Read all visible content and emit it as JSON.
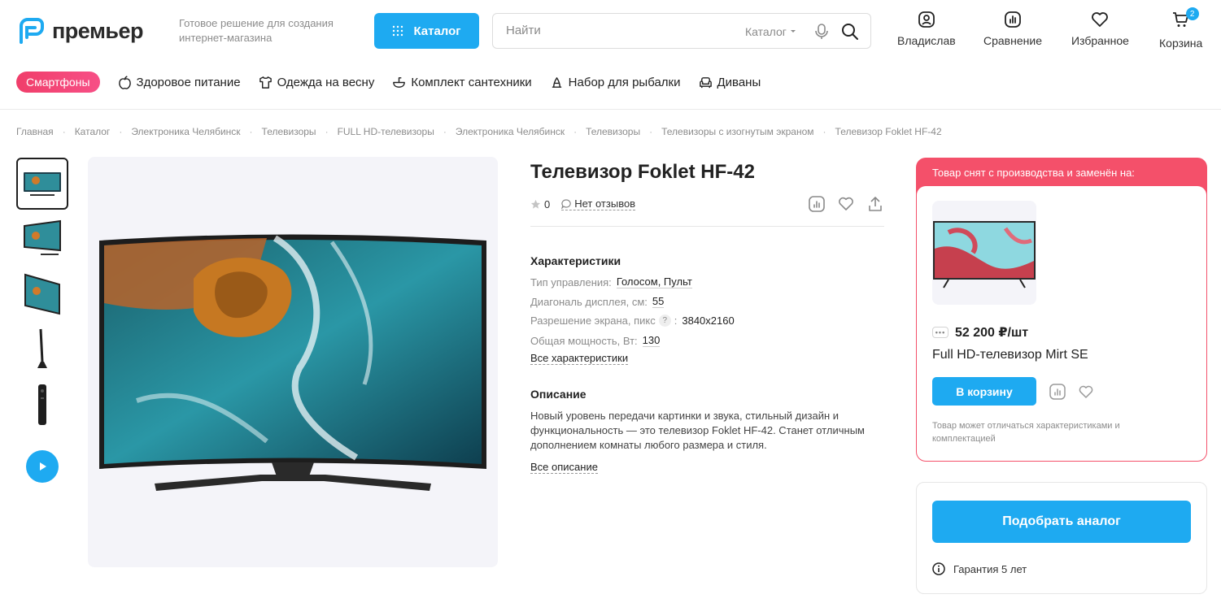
{
  "header": {
    "logo_text": "премьер",
    "slogan": "Готовое решение для создания интернет-магазина",
    "catalog_label": "Каталог",
    "search": {
      "placeholder": "Найти",
      "category": "Каталог"
    },
    "actions": {
      "profile": "Владислав",
      "compare": "Сравнение",
      "favorites": "Избранное",
      "cart": "Корзина",
      "cart_count": "2"
    }
  },
  "categories": [
    {
      "label": "Смартфоны",
      "icon": "none"
    },
    {
      "label": "Здоровое питание",
      "icon": "apple-icon"
    },
    {
      "label": "Одежда на весну",
      "icon": "shirt-icon"
    },
    {
      "label": "Комплект сантехники",
      "icon": "sink-icon"
    },
    {
      "label": "Набор для рыбалки",
      "icon": "fishing-icon"
    },
    {
      "label": "Диваны",
      "icon": "sofa-icon"
    }
  ],
  "breadcrumbs": [
    "Главная",
    "Каталог",
    "Электроника Челябинск",
    "Телевизоры",
    "FULL HD-телевизоры",
    "Электроника Челябинск",
    "Телевизоры",
    "Телевизоры с изогнутым экраном",
    "Телевизор Foklet HF-42"
  ],
  "product": {
    "title": "Телевизор Foklet HF-42",
    "rating": "0",
    "reviews": "Нет отзывов",
    "specs_title": "Характеристики",
    "specs": [
      {
        "name": "Тип управления:",
        "value": "Голосом, Пульт"
      },
      {
        "name": "Диагональ дисплея, см:",
        "value": "55"
      },
      {
        "name": "Разрешение экрана, пикс",
        "value": "3840x2160"
      },
      {
        "name": "Общая мощность, Вт:",
        "value": "130"
      }
    ],
    "all_specs": "Все характеристики",
    "desc_title": "Описание",
    "description": "Новый уровень передачи картинки и звука, стильный дизайн и функциональность — это телевизор Foklet HF-42. Станет отличным дополнением комнаты любого размера и стиля.",
    "all_desc": "Все описание"
  },
  "replacement": {
    "header": "Товар снят с производства и заменён на:",
    "price": "52 200 ₽/шт",
    "name": "Full HD-телевизор Mirt SE",
    "cart_button": "В корзину",
    "note": "Товар может отличаться характеристиками и комплектацией"
  },
  "analog": {
    "button": "Подобрать аналог",
    "warranty": "Гарантия 5 лет"
  },
  "colors": {
    "accent": "#1eaaf1",
    "pink": "#f4506a"
  }
}
